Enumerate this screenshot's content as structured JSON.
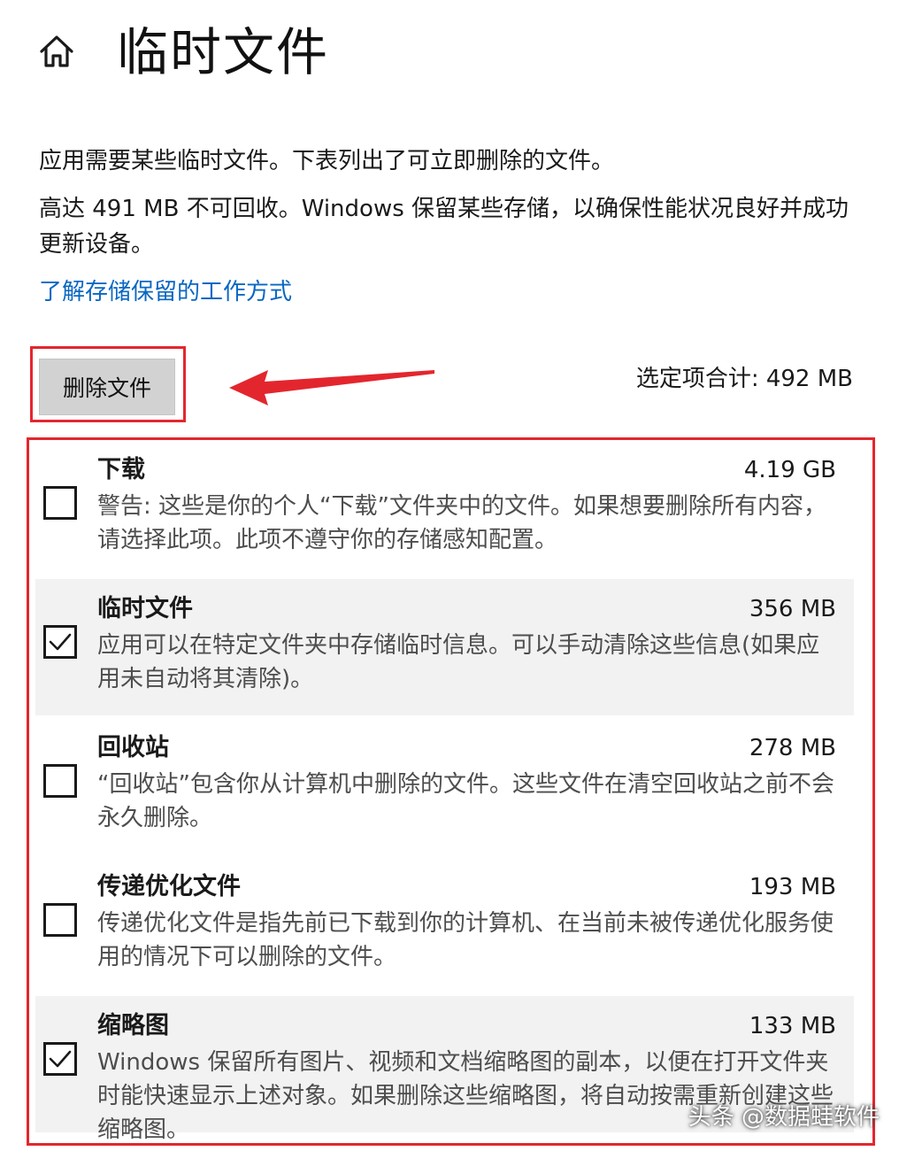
{
  "header": {
    "title": "临时文件",
    "icon": "home-icon"
  },
  "description": {
    "line1": "应用需要某些临时文件。下表列出了可立即删除的文件。",
    "line2": "高达 491 MB 不可回收。Windows 保留某些存储，以确保性能状况良好并成功更新设备。"
  },
  "learn_link": "了解存储保留的工作方式",
  "actions": {
    "delete_label": "删除文件",
    "selected_total": "选定项合计: 492 MB"
  },
  "items": [
    {
      "title": "下载",
      "size": "4.19 GB",
      "checked": false,
      "desc": "警告: 这些是你的个人“下载”文件夹中的文件。如果想要删除所有内容，请选择此项。此项不遵守你的存储感知配置。"
    },
    {
      "title": "临时文件",
      "size": "356 MB",
      "checked": true,
      "desc": "应用可以在特定文件夹中存储临时信息。可以手动清除这些信息(如果应用未自动将其清除)。"
    },
    {
      "title": "回收站",
      "size": "278 MB",
      "checked": false,
      "desc": "“回收站”包含你从计算机中删除的文件。这些文件在清空回收站之前不会永久删除。"
    },
    {
      "title": "传递优化文件",
      "size": "193 MB",
      "checked": false,
      "desc": "传递优化文件是指先前已下载到你的计算机、在当前未被传递优化服务使用的情况下可以删除的文件。"
    },
    {
      "title": "缩略图",
      "size": "133 MB",
      "checked": true,
      "desc": "Windows 保留所有图片、视频和文档缩略图的副本，以便在打开文件夹时能快速显示上述对象。如果删除这些缩略图，将自动按需重新创建这些缩略图。"
    }
  ],
  "watermark": "头条 @数据蛙软件",
  "colors": {
    "accent_link": "#0a67c2",
    "annotation_red": "#e3262e",
    "checked_row_bg": "#f2f2f2"
  }
}
